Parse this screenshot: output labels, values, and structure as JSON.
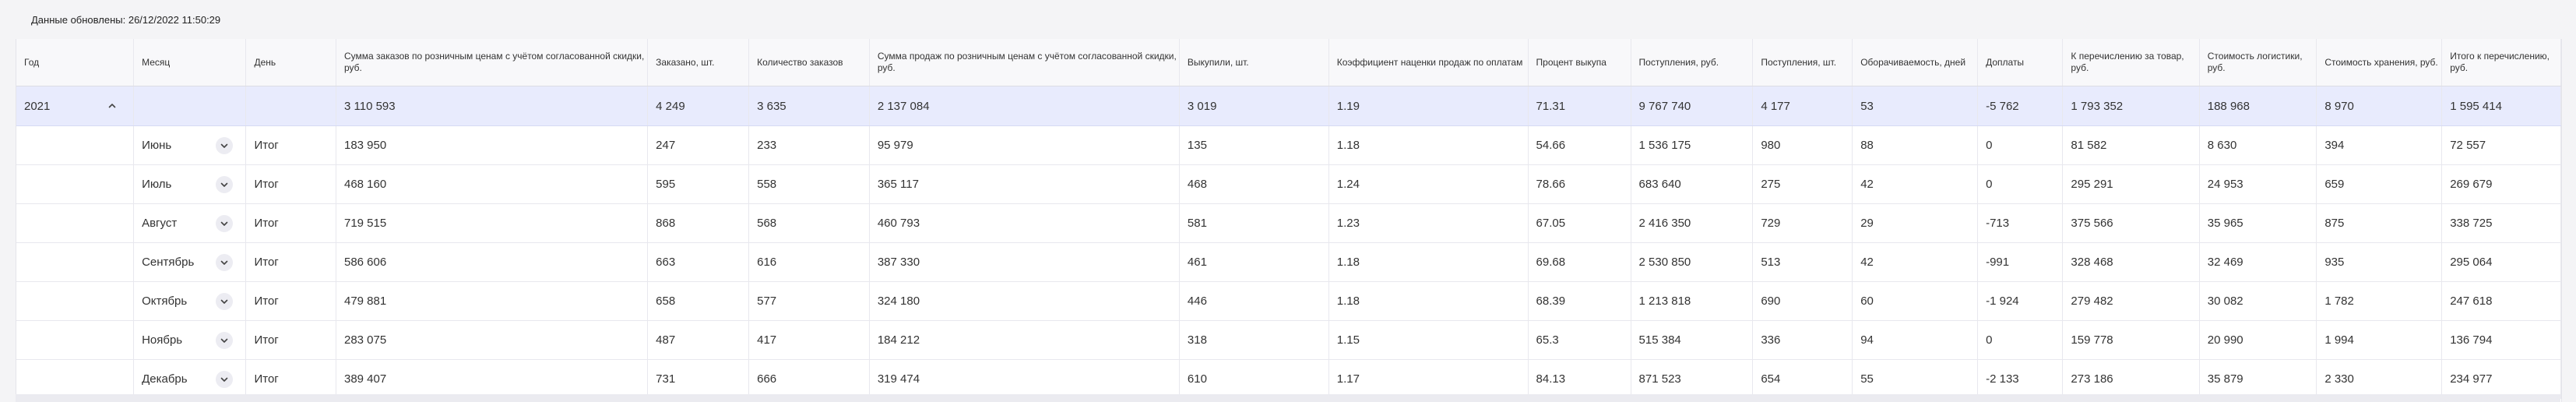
{
  "updated_label": "Данные обновлены: 26/12/2022 11:50:29",
  "columns": [
    "Год",
    "Месяц",
    "День",
    "Сумма заказов по розничным ценам с учётом согласованной скидки, руб.",
    "Заказано, шт.",
    "Количество заказов",
    "Сумма продаж по розничным ценам с учётом согласованной скидки, руб.",
    "Выкупили, шт.",
    "Коэффициент наценки продаж по оплатам",
    "Процент выкупа",
    "Поступления, руб.",
    "Поступления, шт.",
    "Оборачиваемость, дней",
    "Доплаты",
    "К перечислению за товар, руб.",
    "Стоимость логистики, руб.",
    "Стоимость хранения, руб.",
    "Итого к перечислению, руб."
  ],
  "year_row": {
    "year": "2021",
    "values": [
      "3 110 593",
      "4 249",
      "3 635",
      "2 137 084",
      "3 019",
      "1.19",
      "71.31",
      "9 767 740",
      "4 177",
      "53",
      "-5 762",
      "1 793 352",
      "188 968",
      "8 970",
      "1 595 414"
    ]
  },
  "rows": [
    {
      "month": "Июнь",
      "day": "Итог",
      "values": [
        "183 950",
        "247",
        "233",
        "95 979",
        "135",
        "1.18",
        "54.66",
        "1 536 175",
        "980",
        "88",
        "0",
        "81 582",
        "8 630",
        "394",
        "72 557"
      ]
    },
    {
      "month": "Июль",
      "day": "Итог",
      "values": [
        "468 160",
        "595",
        "558",
        "365 117",
        "468",
        "1.24",
        "78.66",
        "683 640",
        "275",
        "42",
        "0",
        "295 291",
        "24 953",
        "659",
        "269 679"
      ]
    },
    {
      "month": "Август",
      "day": "Итог",
      "values": [
        "719 515",
        "868",
        "568",
        "460 793",
        "581",
        "1.23",
        "67.05",
        "2 416 350",
        "729",
        "29",
        "-713",
        "375 566",
        "35 965",
        "875",
        "338 725"
      ]
    },
    {
      "month": "Сентябрь",
      "day": "Итог",
      "values": [
        "586 606",
        "663",
        "616",
        "387 330",
        "461",
        "1.18",
        "69.68",
        "2 530 850",
        "513",
        "42",
        "-991",
        "328 468",
        "32 469",
        "935",
        "295 064"
      ]
    },
    {
      "month": "Октябрь",
      "day": "Итог",
      "values": [
        "479 881",
        "658",
        "577",
        "324 180",
        "446",
        "1.18",
        "68.39",
        "1 213 818",
        "690",
        "60",
        "-1 924",
        "279 482",
        "30 082",
        "1 782",
        "247 618"
      ]
    },
    {
      "month": "Ноябрь",
      "day": "Итог",
      "values": [
        "283 075",
        "487",
        "417",
        "184 212",
        "318",
        "1.15",
        "65.3",
        "515 384",
        "336",
        "94",
        "0",
        "159 778",
        "20 990",
        "1 994",
        "136 794"
      ]
    },
    {
      "month": "Декабрь",
      "day": "Итог",
      "values": [
        "389 407",
        "731",
        "666",
        "319 474",
        "610",
        "1.17",
        "84.13",
        "871 523",
        "654",
        "55",
        "-2 133",
        "273 186",
        "35 879",
        "2 330",
        "234 977"
      ]
    }
  ]
}
